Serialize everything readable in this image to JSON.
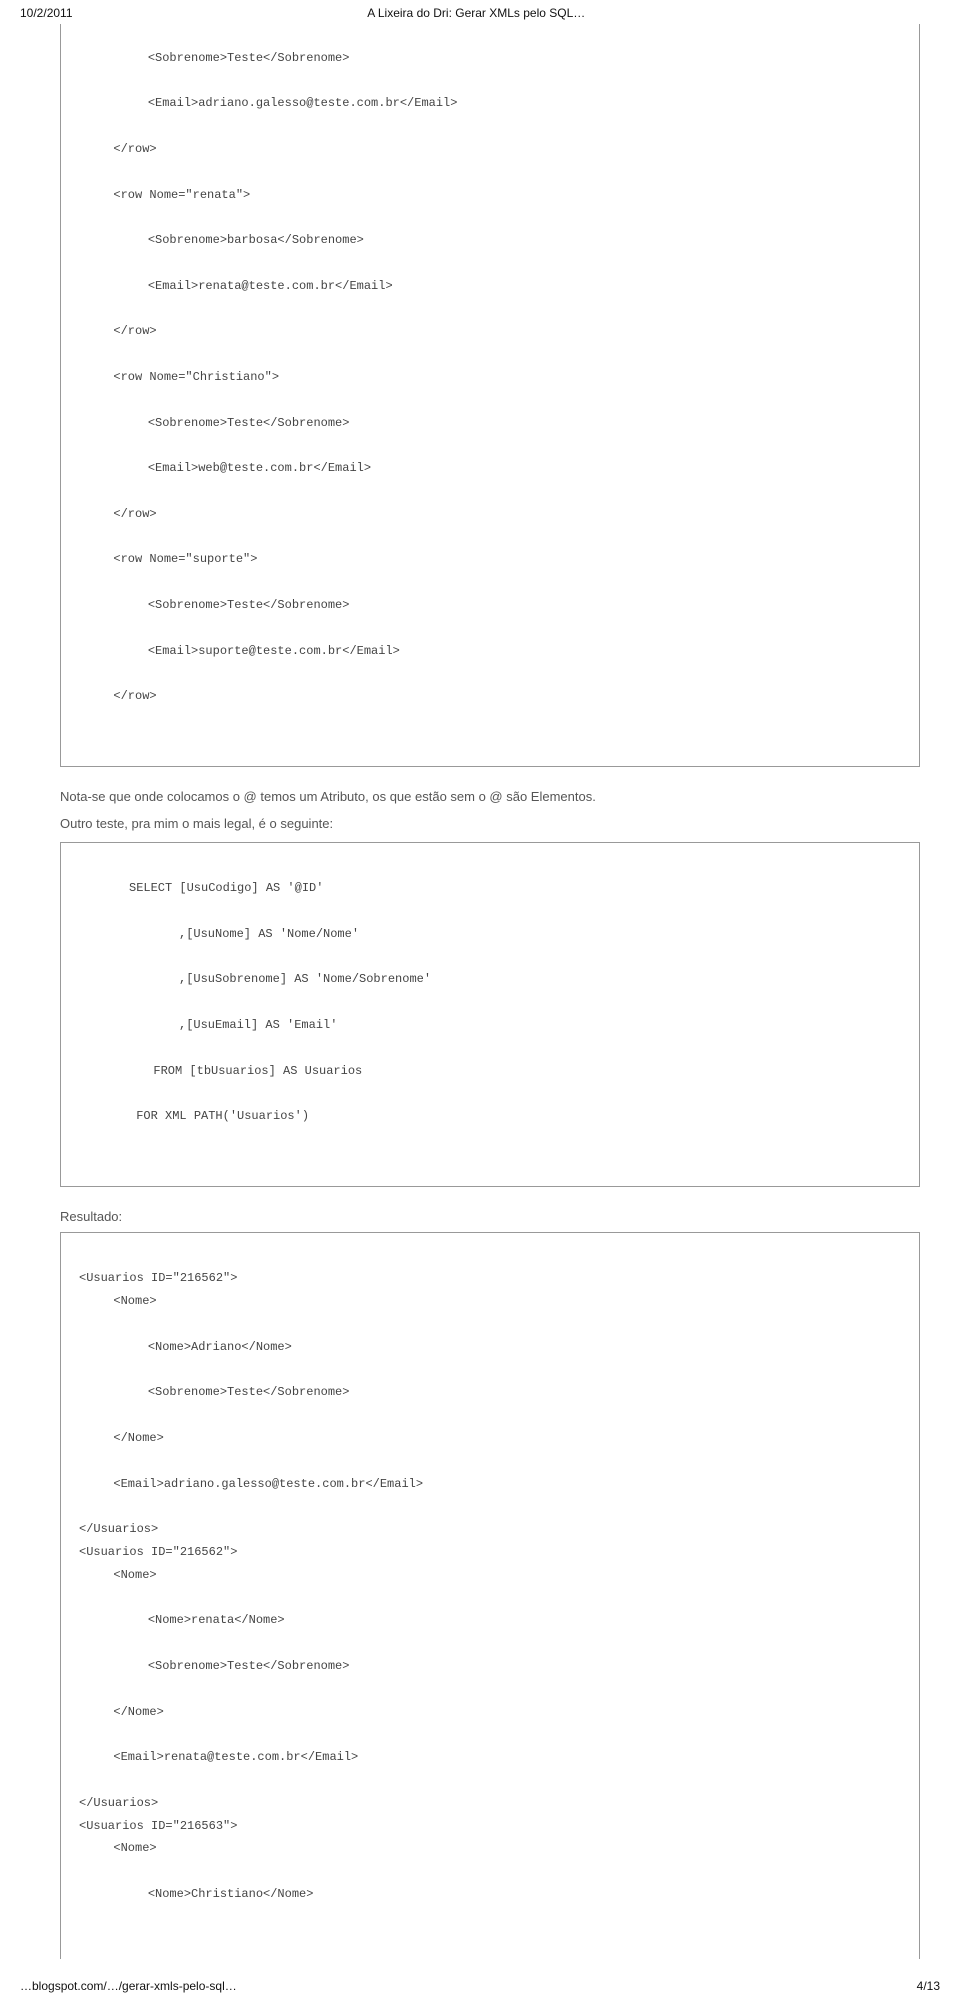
{
  "header": {
    "date": "10/2/2011",
    "title": "A Lixeira do Dri: Gerar XMLs pelo SQL…"
  },
  "code1": {
    "l1": "    <Sobrenome>Teste</Sobrenome>",
    "l2": "    <Email>adriano.galesso@teste.com.br</Email>",
    "l3": "  </row>",
    "l4": "  <row Nome=\"renata\">",
    "l5": "    <Sobrenome>barbosa</Sobrenome>",
    "l6": "    <Email>renata@teste.com.br</Email>",
    "l7": "  </row>",
    "l8": "  <row Nome=\"Christiano\">",
    "l9": "    <Sobrenome>Teste</Sobrenome>",
    "l10": "    <Email>web@teste.com.br</Email>",
    "l11": "  </row>",
    "l12": "  <row Nome=\"suporte\">",
    "l13": "    <Sobrenome>Teste</Sobrenome>",
    "l14": "    <Email>suporte@teste.com.br</Email>",
    "l15": "  </row>"
  },
  "prose1": "Nota-se que onde colocamos o @ temos um Atributo, os que estão sem o @ são Elementos.",
  "prose2": "Outro teste, pra mim o mais legal, é o seguinte:",
  "code2": {
    "l1": "SELECT [UsuCodigo] AS '@ID'",
    "l2": ",[UsuNome] AS 'Nome/Nome'",
    "l3": ",[UsuSobrenome] AS 'Nome/Sobrenome'",
    "l4": ",[UsuEmail] AS 'Email'",
    "l5": "  FROM [tbUsuarios] AS Usuarios",
    "l6": " FOR XML PATH('Usuarios')"
  },
  "resultLabel": "Resultado:",
  "code3": {
    "l1": "<Usuarios ID=\"216562\">",
    "l2": "  <Nome>",
    "l3": "    <Nome>Adriano</Nome>",
    "l4": "    <Sobrenome>Teste</Sobrenome>",
    "l5": "  </Nome>",
    "l6": "  <Email>adriano.galesso@teste.com.br</Email>",
    "l7": "</Usuarios>",
    "l8": "<Usuarios ID=\"216562\">",
    "l9": "  <Nome>",
    "l10": "    <Nome>renata</Nome>",
    "l11": "    <Sobrenome>Teste</Sobrenome>",
    "l12": "  </Nome>",
    "l13": "  <Email>renata@teste.com.br</Email>",
    "l14": "</Usuarios>",
    "l15": "<Usuarios ID=\"216563\">",
    "l16": "  <Nome>",
    "l17": "    <Nome>Christiano</Nome>"
  },
  "footer": {
    "left": "…blogspot.com/…/gerar-xmls-pelo-sql…",
    "right": "4/13"
  }
}
